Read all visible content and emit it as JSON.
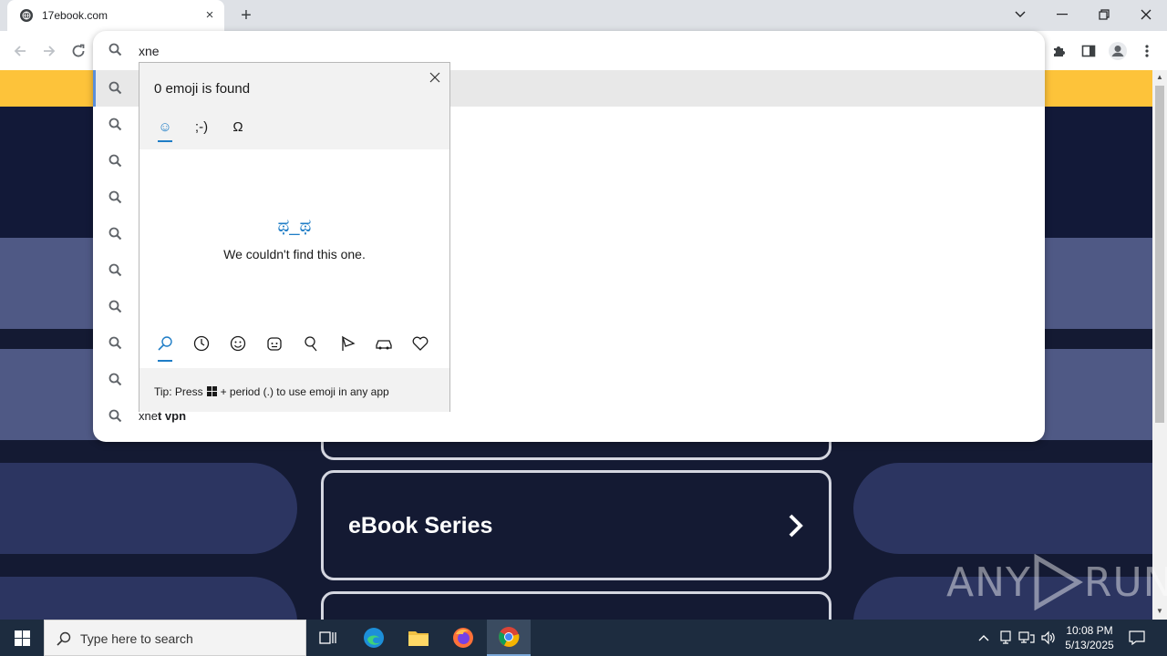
{
  "browser": {
    "tab_title": "17ebook.com",
    "new_tab_symbol": "+",
    "tab_close_symbol": "×",
    "address_value": "xne"
  },
  "omnibox": {
    "suggestions": [
      {
        "typed": "",
        "rest": "",
        "selected": true
      },
      {
        "typed": "",
        "rest": ""
      },
      {
        "typed": "",
        "rest": ""
      },
      {
        "typed": "",
        "rest": ""
      },
      {
        "typed": "",
        "rest": ""
      },
      {
        "typed": "",
        "rest": ""
      },
      {
        "typed": "",
        "rest": ""
      },
      {
        "typed": "",
        "rest": ""
      },
      {
        "typed": "",
        "rest": ""
      },
      {
        "typed": "xne",
        "rest": "t vpn"
      }
    ]
  },
  "emoji_panel": {
    "title": "0 emoji is found",
    "tabs": [
      {
        "name": "emoji",
        "label": "☺",
        "active": true
      },
      {
        "name": "kaomoji",
        "label": ";-)"
      },
      {
        "name": "symbols",
        "label": "Ω"
      }
    ],
    "empty_kaomoji": "ಥ_ಥ",
    "empty_message": "We couldn't find this one.",
    "bottom_categories": [
      "search",
      "recent",
      "smiley",
      "people",
      "celebration",
      "food",
      "travel",
      "heart"
    ],
    "tip_prefix": "Tip: Press",
    "tip_suffix": "+ period (.) to use emoji in any app"
  },
  "page": {
    "card_title": "eBook Series",
    "colors": {
      "yellow_bar": "#fdc33a",
      "background": "#141a33",
      "band": "#4f5985",
      "pill": "#2c3561"
    }
  },
  "watermark": {
    "text_left": "ANY",
    "text_right": "RUN"
  },
  "taskbar": {
    "search_placeholder": "Type here to search",
    "time": "10:08 PM",
    "date": "5/13/2025"
  }
}
